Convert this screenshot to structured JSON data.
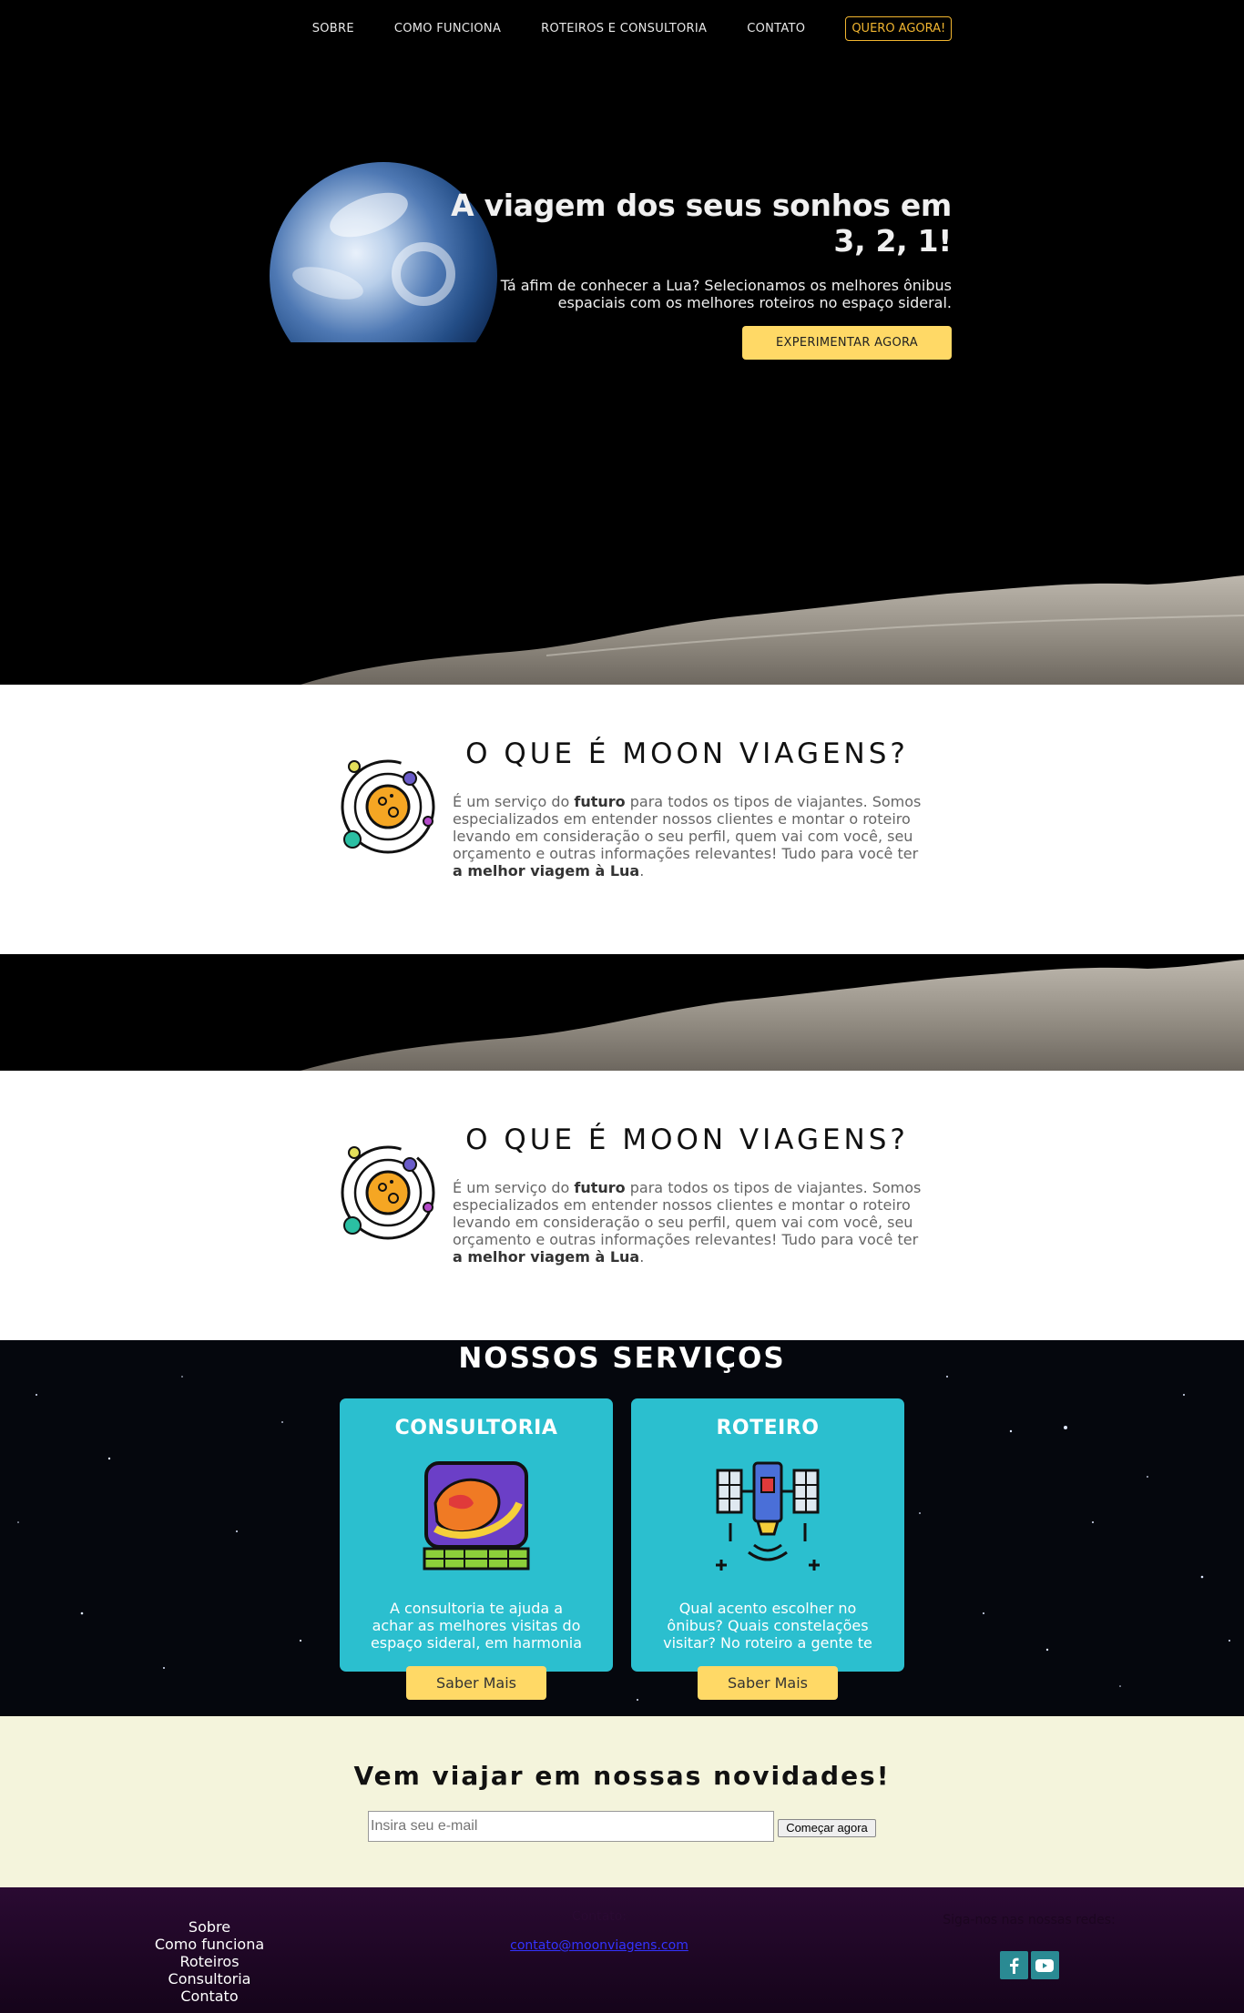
{
  "nav": {
    "items": [
      "SOBRE",
      "COMO FUNCIONA",
      "ROTEIROS E CONSULTORIA",
      "CONTATO"
    ],
    "cta": "QUERO AGORA!"
  },
  "hero": {
    "title": "A viagem dos seus sonhos em 3, 2, 1!",
    "subtitle": "Tá afim de conhecer a Lua? Selecionamos os melhores ônibus espaciais com os melhores roteiros no espaço sideral.",
    "button": "EXPERIMENTAR AGORA"
  },
  "about": {
    "title": "O QUE É MOON VIAGENS?",
    "text_1": "É um serviço do ",
    "text_bold_1": "futuro",
    "text_2": " para todos os tipos de viajantes. Somos especializados em entender nossos clientes e montar o roteiro levando em consideração o seu perfil, quem vai com você, seu orçamento e outras informações relevantes! Tudo para você ter ",
    "text_bold_2": "a melhor viagem à Lua",
    "text_3": "."
  },
  "services": {
    "title": "NOSSOS SERVIÇOS",
    "cards": [
      {
        "title": "CONSULTORIA",
        "text": "A consultoria te ajuda a achar as melhores visitas do espaço sideral, em harmonia com quem você é",
        "button": "Saber Mais",
        "icon": "planet-screen-icon"
      },
      {
        "title": "ROTEIRO",
        "text": "Qual acento escolher no ônibus? Quais constelações visitar? No roteiro a gente te ajuda a descobrir.",
        "button": "Saber Mais",
        "icon": "satellite-icon"
      }
    ]
  },
  "newsletter": {
    "title": "Vem viajar em nossas novidades!",
    "placeholder": "Insira seu e-mail",
    "button": "Começar agora"
  },
  "footer": {
    "links": [
      "Sobre",
      "Como funciona",
      "Roteiros",
      "Consultoria",
      "Contato"
    ],
    "contact_label": "Contato:",
    "email": "contato@moonviagens.com",
    "social_label": "Siga-nos nas nossas redes:"
  },
  "colors": {
    "accent_yellow": "#ffd966",
    "nav_cta": "#f2b630",
    "card_teal": "#2bbfcf",
    "newsletter_bg": "#f4f4dc",
    "footer_bg": "#2a0a32"
  }
}
